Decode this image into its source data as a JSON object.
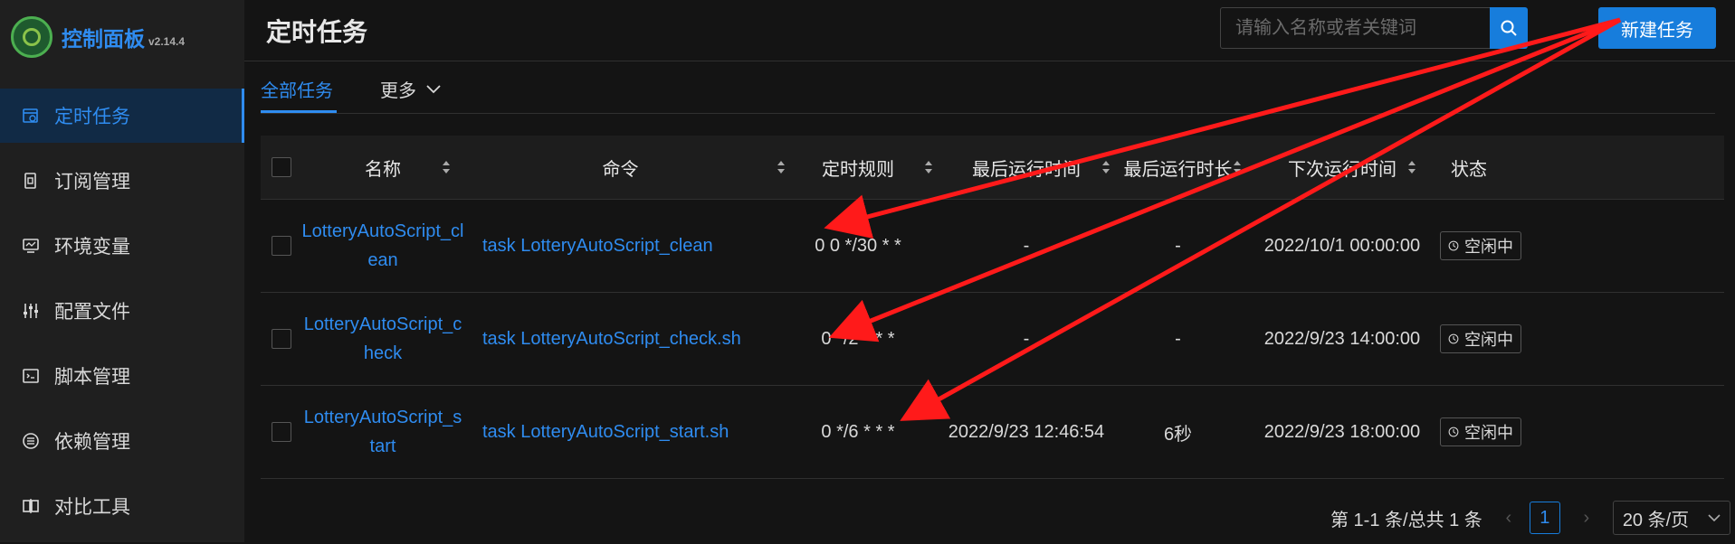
{
  "app": {
    "title": "控制面板",
    "version": "v2.14.4"
  },
  "sidebar": {
    "items": [
      {
        "label": "定时任务",
        "icon": "clock-calendar-icon",
        "active": true
      },
      {
        "label": "订阅管理",
        "icon": "subscription-icon",
        "active": false
      },
      {
        "label": "环境变量",
        "icon": "monitor-icon",
        "active": false
      },
      {
        "label": "配置文件",
        "icon": "sliders-icon",
        "active": false
      },
      {
        "label": "脚本管理",
        "icon": "code-icon",
        "active": false
      },
      {
        "label": "依赖管理",
        "icon": "list-circle-icon",
        "active": false
      },
      {
        "label": "对比工具",
        "icon": "diff-icon",
        "active": false
      }
    ]
  },
  "header": {
    "title": "定时任务",
    "search_placeholder": "请输入名称或者关键词",
    "new_button": "新建任务"
  },
  "tabs": {
    "all": "全部任务",
    "more": "更多"
  },
  "table": {
    "columns": [
      "名称",
      "命令",
      "定时规则",
      "最后运行时间",
      "最后运行时长",
      "下次运行时间",
      "状态"
    ],
    "rows": [
      {
        "name": "LotteryAutoScript_clean",
        "command": "task LotteryAutoScript_clean",
        "schedule": "0 0 */30 * *",
        "last_run": "-",
        "duration": "-",
        "next_run": "2022/10/1 00:00:00",
        "status": "空闲中"
      },
      {
        "name": "LotteryAutoScript_check",
        "command": "task LotteryAutoScript_check.sh",
        "schedule": "0 */2 * * *",
        "last_run": "-",
        "duration": "-",
        "next_run": "2022/9/23 14:00:00",
        "status": "空闲中"
      },
      {
        "name": "LotteryAutoScript_start",
        "command": "task LotteryAutoScript_start.sh",
        "schedule": "0 */6 * * *",
        "last_run": "2022/9/23 12:46:54",
        "duration": "6秒",
        "next_run": "2022/9/23 18:00:00",
        "status": "空闲中"
      }
    ]
  },
  "pagination": {
    "total": "第 1-1 条/总共 1 条",
    "current": "1",
    "page_size": "20 条/页"
  },
  "colors": {
    "accent": "#177ddc",
    "link": "#2f8cf0",
    "annotation_arrow": "#ff1a1a"
  }
}
